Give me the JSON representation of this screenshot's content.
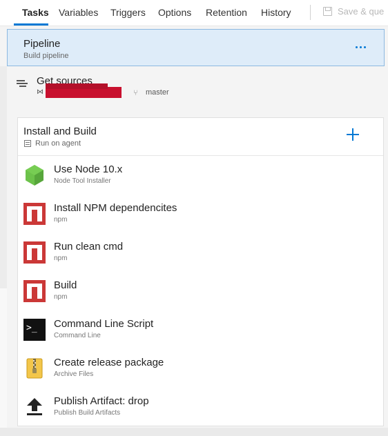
{
  "tabs": [
    "Tasks",
    "Variables",
    "Triggers",
    "Options",
    "Retention",
    "History"
  ],
  "toolbar": {
    "save_label": "Save & que"
  },
  "pipeline": {
    "title": "Pipeline",
    "subtitle": "Build pipeline"
  },
  "get_sources": {
    "title": "Get sources",
    "branch": "master"
  },
  "phase": {
    "title": "Install and Build",
    "subtitle": "Run on agent"
  },
  "tasks": [
    {
      "title": "Use Node 10.x",
      "subtitle": "Node Tool Installer",
      "icon": "node-icon"
    },
    {
      "title": "Install NPM dependencites",
      "subtitle": "npm",
      "icon": "npm-icon"
    },
    {
      "title": "Run clean cmd",
      "subtitle": "npm",
      "icon": "npm-icon"
    },
    {
      "title": "Build",
      "subtitle": "npm",
      "icon": "npm-icon"
    },
    {
      "title": "Command Line Script",
      "subtitle": "Command Line",
      "icon": "terminal-icon"
    },
    {
      "title": "Create release package",
      "subtitle": "Archive Files",
      "icon": "zip-icon"
    },
    {
      "title": "Publish Artifact: drop",
      "subtitle": "Publish Build Artifacts",
      "icon": "upload-icon"
    }
  ],
  "colors": {
    "accent": "#0078d4",
    "selected_bg": "#deecf9",
    "npm_red": "#cb3837",
    "node_green": "#6cc24a"
  }
}
